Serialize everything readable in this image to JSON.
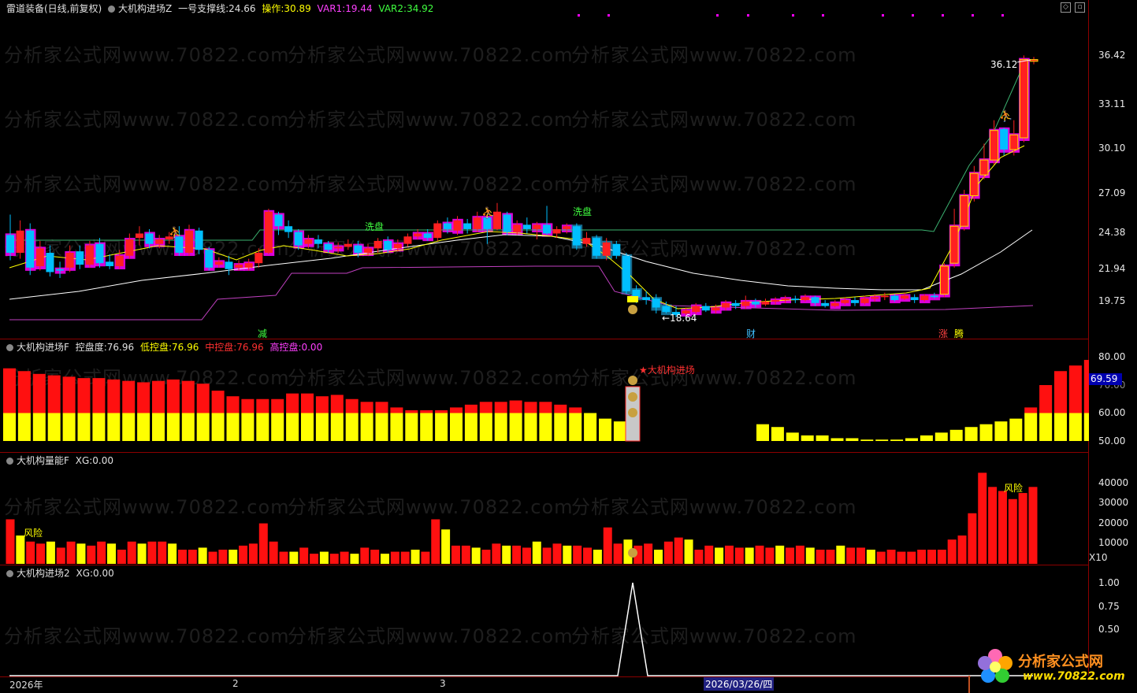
{
  "header": {
    "stock": "雷道装备(日线,前复权)",
    "indicator": "大机构进场Z",
    "support_label": "一号支撑线:",
    "support_value": "24.66",
    "op_label": "操作:",
    "op_value": "30.89",
    "var1_label": "VAR1:",
    "var1_value": "19.44",
    "var2_label": "VAR2:",
    "var2_value": "34.92"
  },
  "panel2": {
    "name": "大机构进场F",
    "k1": "控盘度:",
    "v1": "76.96",
    "k2": "低控盘:",
    "v2": "76.96",
    "k3": "中控盘:",
    "v3": "76.96",
    "k4": "高控盘:",
    "v4": "0.00",
    "signal": "★大机构进场",
    "current_tag": "69.59"
  },
  "panel3": {
    "name": "大机构量能F",
    "k1": "XG:",
    "v1": "0.00",
    "risk1": "风险",
    "risk2": "风险",
    "scale": "X10"
  },
  "panel4": {
    "name": "大机构进场2",
    "k1": "XG:",
    "v1": "0.00"
  },
  "main_labels": {
    "xipan1": "洗盘",
    "xipan2": "洗盘",
    "jian": "减",
    "cai": "财",
    "zhang": "涨",
    "teng": "腾",
    "high": "36.12",
    "low": "←18.64"
  },
  "axes": {
    "main": [
      "36.42",
      "33.11",
      "30.10",
      "27.09",
      "24.38",
      "21.94",
      "19.75"
    ],
    "p2": [
      "80.00",
      "70.00",
      "60.00",
      "50.00"
    ],
    "p3": [
      "40000",
      "30000",
      "20000",
      "10000"
    ],
    "p4": [
      "1.00",
      "0.75",
      "0.50"
    ]
  },
  "dates": {
    "d1": "2026年",
    "d2": "2",
    "d3": "3",
    "cursor": "2026/03/26/四"
  },
  "watermark": "分析家公式网www.70822.com",
  "logo": {
    "text": "分析家公式网",
    "url": "www.70822.com"
  },
  "colors": {
    "up": "#ff2020",
    "down": "#00bfff",
    "ma": "#ffffff",
    "magenta": "#ff00ff",
    "yellow": "#ffff00",
    "support": "#3cb371"
  },
  "chart_data": {
    "type": "candlestick",
    "ylim": [
      18.0,
      38.0
    ],
    "candles": [
      [
        24.2,
        23.0,
        25.6,
        22.5
      ],
      [
        23.0,
        24.5,
        25.2,
        22.6
      ],
      [
        24.5,
        22.0,
        25.0,
        21.5
      ],
      [
        22.1,
        23.3,
        23.8,
        21.8
      ],
      [
        23.0,
        21.7,
        23.5,
        21.4
      ],
      [
        21.9,
        21.8,
        22.4,
        21.3
      ],
      [
        22.0,
        23.0,
        23.5,
        21.7
      ],
      [
        23.1,
        22.2,
        23.5,
        21.9
      ],
      [
        22.2,
        23.5,
        23.8,
        22.0
      ],
      [
        23.6,
        22.3,
        24.0,
        22.0
      ],
      [
        22.4,
        22.1,
        22.9,
        21.9
      ],
      [
        22.1,
        22.8,
        23.2,
        21.9
      ],
      [
        22.8,
        23.9,
        24.3,
        22.6
      ],
      [
        24.0,
        24.3,
        24.8,
        23.5
      ],
      [
        24.3,
        23.6,
        24.6,
        23.3
      ],
      [
        23.6,
        23.9,
        24.2,
        23.3
      ],
      [
        23.9,
        24.1,
        24.4,
        23.6
      ],
      [
        24.1,
        23.0,
        24.8,
        22.8
      ],
      [
        23.0,
        24.5,
        24.9,
        22.8
      ],
      [
        24.5,
        23.2,
        24.7,
        22.9
      ],
      [
        23.2,
        22.0,
        23.4,
        21.8
      ],
      [
        22.2,
        22.4,
        22.7,
        22.0
      ],
      [
        22.4,
        21.9,
        22.8,
        21.5
      ],
      [
        22.0,
        22.2,
        22.5,
        21.8
      ],
      [
        22.0,
        22.3,
        22.6,
        21.8
      ],
      [
        22.3,
        23.0,
        23.3,
        22.0
      ],
      [
        23.0,
        25.8,
        26.0,
        22.9
      ],
      [
        25.6,
        24.8,
        25.8,
        24.2
      ],
      [
        24.8,
        24.4,
        25.2,
        24.0
      ],
      [
        24.4,
        23.5,
        24.6,
        23.2
      ],
      [
        23.6,
        23.9,
        24.2,
        23.3
      ],
      [
        23.9,
        23.6,
        24.2,
        23.3
      ],
      [
        23.6,
        23.2,
        23.8,
        23.0
      ],
      [
        23.3,
        23.4,
        23.7,
        23.0
      ],
      [
        23.4,
        23.6,
        23.9,
        23.2
      ],
      [
        23.5,
        23.0,
        23.8,
        22.7
      ],
      [
        23.0,
        23.3,
        23.6,
        22.8
      ],
      [
        23.3,
        23.8,
        24.0,
        23.0
      ],
      [
        23.8,
        23.2,
        24.1,
        23.0
      ],
      [
        23.3,
        23.6,
        23.9,
        23.1
      ],
      [
        23.6,
        24.1,
        24.3,
        23.4
      ],
      [
        24.1,
        24.3,
        24.6,
        23.9
      ],
      [
        24.3,
        24.0,
        24.6,
        23.8
      ],
      [
        24.0,
        25.0,
        25.2,
        23.8
      ],
      [
        25.0,
        24.6,
        25.4,
        24.3
      ],
      [
        24.5,
        25.2,
        25.5,
        24.2
      ],
      [
        25.0,
        24.6,
        25.3,
        24.3
      ],
      [
        24.6,
        25.4,
        25.8,
        24.4
      ],
      [
        25.4,
        24.6,
        25.6,
        23.6
      ],
      [
        24.6,
        25.8,
        26.4,
        24.5
      ],
      [
        25.6,
        24.4,
        25.8,
        24.2
      ],
      [
        24.4,
        24.9,
        25.2,
        24.2
      ],
      [
        24.9,
        24.6,
        25.4,
        24.3
      ],
      [
        24.6,
        24.9,
        25.1,
        23.9
      ],
      [
        24.9,
        24.3,
        26.2,
        24.2
      ],
      [
        24.3,
        24.6,
        24.8,
        24.0
      ],
      [
        24.6,
        24.8,
        25.0,
        24.3
      ],
      [
        24.8,
        23.5,
        25.0,
        23.2
      ],
      [
        23.6,
        24.0,
        24.4,
        23.4
      ],
      [
        24.0,
        22.8,
        24.2,
        22.6
      ],
      [
        22.8,
        23.7,
        24.0,
        22.5
      ],
      [
        23.6,
        22.8,
        23.8,
        22.6
      ],
      [
        22.8,
        20.4,
        23.0,
        20.2
      ],
      [
        20.5,
        20.0,
        20.8,
        19.6
      ],
      [
        20.0,
        19.8,
        20.4,
        19.5
      ],
      [
        19.9,
        19.3,
        20.2,
        18.9
      ],
      [
        19.4,
        19.0,
        19.7,
        18.9
      ],
      [
        19.0,
        18.8,
        19.4,
        18.64
      ],
      [
        18.9,
        19.1,
        19.3,
        18.8
      ],
      [
        19.0,
        19.4,
        19.6,
        18.9
      ],
      [
        19.4,
        19.1,
        19.6,
        19.0
      ],
      [
        19.1,
        19.3,
        19.5,
        18.9
      ],
      [
        19.3,
        19.6,
        19.8,
        19.1
      ],
      [
        19.6,
        19.4,
        19.8,
        19.2
      ],
      [
        19.4,
        19.7,
        20.1,
        19.2
      ],
      [
        19.7,
        19.5,
        19.9,
        19.3
      ],
      [
        19.5,
        19.7,
        19.9,
        19.4
      ],
      [
        19.7,
        19.8,
        20.0,
        19.5
      ],
      [
        19.8,
        19.9,
        20.1,
        19.6
      ],
      [
        19.9,
        19.8,
        20.1,
        19.6
      ],
      [
        19.8,
        20.0,
        20.2,
        19.7
      ],
      [
        20.0,
        19.6,
        20.1,
        19.4
      ],
      [
        19.6,
        19.4,
        19.8,
        19.3
      ],
      [
        19.4,
        19.6,
        19.8,
        19.3
      ],
      [
        19.6,
        19.8,
        20.0,
        19.5
      ],
      [
        19.8,
        19.6,
        20.0,
        19.4
      ],
      [
        19.6,
        19.9,
        20.1,
        19.5
      ],
      [
        19.9,
        20.0,
        20.2,
        19.7
      ],
      [
        20.0,
        20.1,
        20.3,
        19.8
      ],
      [
        20.1,
        19.8,
        20.2,
        19.7
      ],
      [
        19.9,
        20.1,
        20.3,
        19.8
      ],
      [
        20.0,
        19.8,
        20.2,
        19.6
      ],
      [
        19.8,
        20.1,
        20.2,
        19.7
      ],
      [
        20.1,
        20.0,
        20.3,
        19.9
      ],
      [
        20.2,
        22.1,
        22.3,
        20.0
      ],
      [
        22.3,
        24.8,
        26.0,
        22.0
      ],
      [
        24.8,
        26.9,
        27.3,
        24.5
      ],
      [
        26.9,
        28.4,
        28.9,
        26.5
      ],
      [
        28.3,
        29.3,
        30.4,
        28.0
      ],
      [
        29.3,
        31.3,
        32.0,
        29.0
      ],
      [
        31.4,
        30.0,
        31.5,
        29.6
      ],
      [
        30.0,
        31.0,
        32.0,
        29.6
      ],
      [
        30.8,
        36.12,
        36.4,
        30.5
      ],
      [
        36.0,
        36.12,
        36.3,
        35.8
      ]
    ]
  }
}
